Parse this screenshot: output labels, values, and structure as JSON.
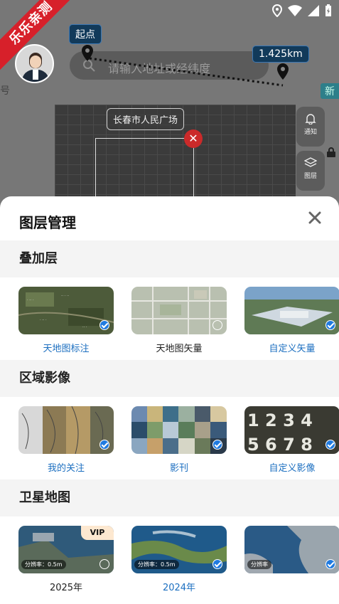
{
  "brand_ribbon": "乐乐亲测",
  "map": {
    "start_label": "起点",
    "distance_label": "1.425km",
    "search_placeholder": "请输入地址或经纬度",
    "place_label": "长春市人民广场",
    "side_new": "新",
    "side_char": "号",
    "notify_label": "通知",
    "layer_label": "图层"
  },
  "sheet": {
    "title": "图层管理",
    "sections": [
      {
        "title": "叠加层",
        "items": [
          {
            "label": "天地图标注",
            "selected": true
          },
          {
            "label": "天地图矢量",
            "selected": false
          },
          {
            "label": "自定义矢量",
            "selected": true
          }
        ]
      },
      {
        "title": "区域影像",
        "items": [
          {
            "label": "我的关注",
            "selected": true
          },
          {
            "label": "影刊",
            "selected": true
          },
          {
            "label": "自定义影像",
            "selected": true
          }
        ]
      },
      {
        "title": "卫星地图",
        "items": [
          {
            "label": "2025年",
            "selected": false,
            "badge": "VIP",
            "resolution": "分辨率：0.5m"
          },
          {
            "label": "2024年",
            "selected": true,
            "resolution": "分辨率：0.5m"
          },
          {
            "label": "",
            "selected": true,
            "resolution": "分辨率"
          }
        ]
      }
    ]
  },
  "colors": {
    "accent": "#1f7ae0",
    "selected_text": "#1c6fc0",
    "ribbon": "#d7202a",
    "section_bg": "#f4f4f4"
  }
}
